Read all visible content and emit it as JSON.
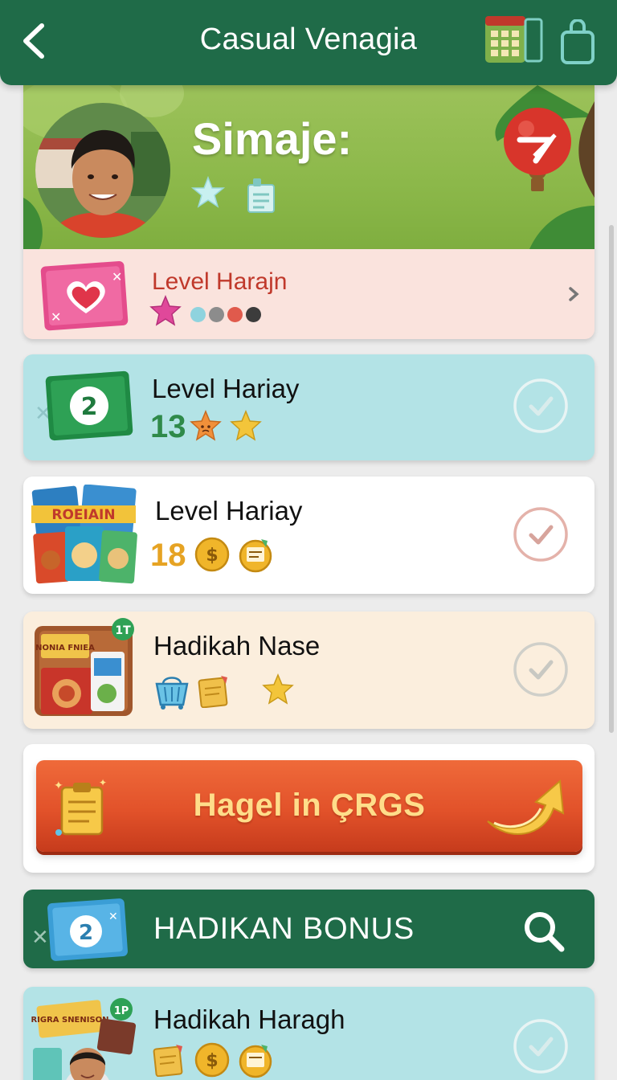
{
  "header": {
    "title": "Casual Venagia"
  },
  "profile": {
    "name": "Simaje:",
    "level_label": "Level Harajn",
    "dot_colors": [
      "#8fd3de",
      "#8c8c8c",
      "#e05a4c",
      "#3c3c3c"
    ]
  },
  "tasks": [
    {
      "title": "Level Hariay",
      "number": "13"
    },
    {
      "title": "Level Hariay",
      "number": "18"
    },
    {
      "title": "Hadikah Nase"
    },
    {
      "title": "Hadikah Haragh"
    }
  ],
  "cta": {
    "label": "Hagel in ÇRGS"
  },
  "bonus": {
    "label": "HADIKAN BONUS",
    "ticket_number": "2"
  },
  "ticket_numbers": {
    "task1": "2"
  },
  "thumbnails": {
    "task2_text": "ROEIAIN",
    "task3_sign": "NONIA FNIEA",
    "task4_sign": "RIGRA SNENISON",
    "task4_badge": "1P",
    "task3_badge": "1T"
  },
  "colors": {
    "header_green": "#1f6b48",
    "task1_bg": "#b3e3e6",
    "task2_bg": "#ffffff",
    "task3_bg": "#fbeedd",
    "task4_bg": "#b3e3e6",
    "cta_orange": "#e2522a",
    "number_green": "#2f8a4a",
    "number_gold": "#e6a323"
  },
  "icons": [
    "back-arrow-icon",
    "calendar-icon",
    "shopping-bag-icon",
    "star-icon",
    "document-icon",
    "heart-ticket-icon",
    "check-circle-icon",
    "coin-icon",
    "basket-icon",
    "clipboard-icon",
    "search-icon",
    "chevron-right-icon"
  ]
}
